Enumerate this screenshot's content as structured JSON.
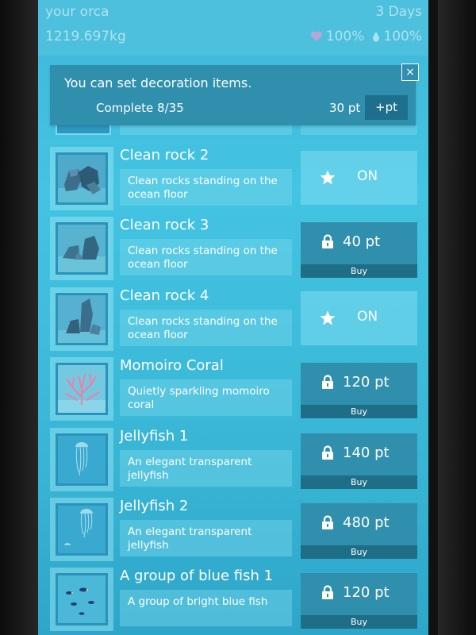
{
  "header": {
    "orca_name": "your orca",
    "days": "3 Days",
    "weight": "1219.697kg",
    "heart_value": "100%",
    "water_value": "100%"
  },
  "panel": {
    "message": "You can set decoration items.",
    "complete": "Complete 8/35",
    "points": "30 pt",
    "add_points_label": "+pt",
    "close_label": "×"
  },
  "items": [
    {
      "name": "Clean rock 2",
      "description": "Clean rocks standing on the ocean floor",
      "state": "on",
      "action_label": "ON",
      "icon": "star-icon"
    },
    {
      "name": "Clean rock 3",
      "description": "Clean rocks standing on the ocean floor",
      "state": "locked",
      "price": "40 pt",
      "buy_label": "Buy",
      "icon": "lock-icon"
    },
    {
      "name": "Clean rock 4",
      "description": "Clean rocks standing on the ocean floor",
      "state": "on",
      "action_label": "ON",
      "icon": "star-icon"
    },
    {
      "name": "Momoiro Coral",
      "description": "Quietly sparkling momoiro coral",
      "state": "locked",
      "price": "120 pt",
      "buy_label": "Buy",
      "icon": "lock-icon"
    },
    {
      "name": "Jellyfish 1",
      "description": "An elegant transparent jellyfish",
      "state": "locked",
      "price": "140 pt",
      "buy_label": "Buy",
      "icon": "lock-icon"
    },
    {
      "name": "Jellyfish 2",
      "description": "An elegant transparent jellyfish",
      "state": "locked",
      "price": "480 pt",
      "buy_label": "Buy",
      "icon": "lock-icon"
    },
    {
      "name": "A group of blue fish 1",
      "description": "A group of bright blue fish",
      "state": "locked",
      "price": "120 pt",
      "buy_label": "Buy",
      "icon": "lock-icon"
    }
  ],
  "colors": {
    "panel": "#2f8fad",
    "buy_bar": "#1f6e87",
    "background": "#43c4e2"
  }
}
